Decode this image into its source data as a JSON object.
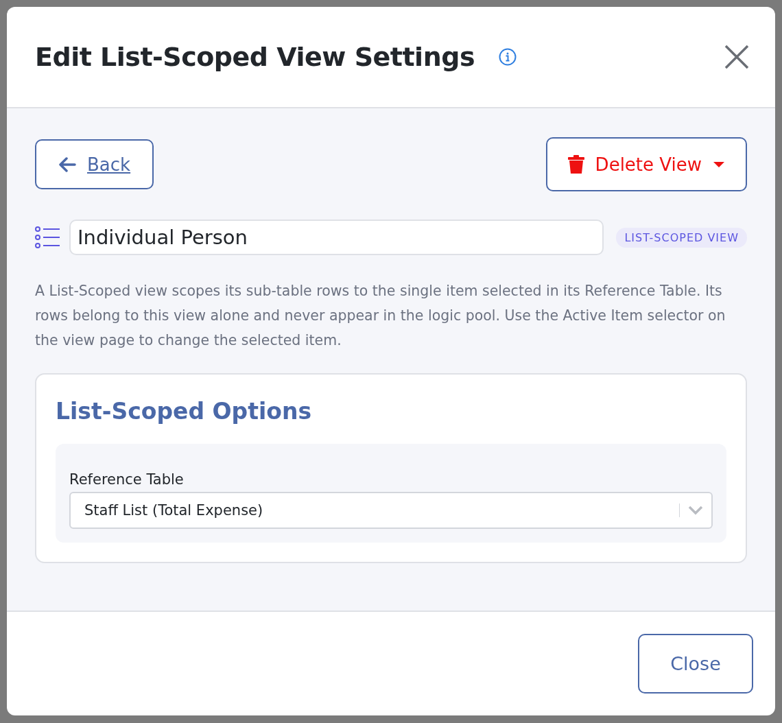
{
  "dialog": {
    "title": "Edit List-Scoped View Settings",
    "back_button": "Back",
    "delete_button": "Delete View",
    "view_name": "Individual Person",
    "view_badge": "LIST-SCOPED VIEW",
    "description": "A List-Scoped view scopes its sub-table rows to the single item selected in its Reference Table. Its rows belong to this view alone and never appear in the logic pool. Use the Active Item selector on the view page to change the selected item.",
    "options": {
      "title": "List-Scoped Options",
      "field_label": "Reference Table",
      "field_value": "Staff List (Total Expense)"
    },
    "close_button": "Close"
  }
}
